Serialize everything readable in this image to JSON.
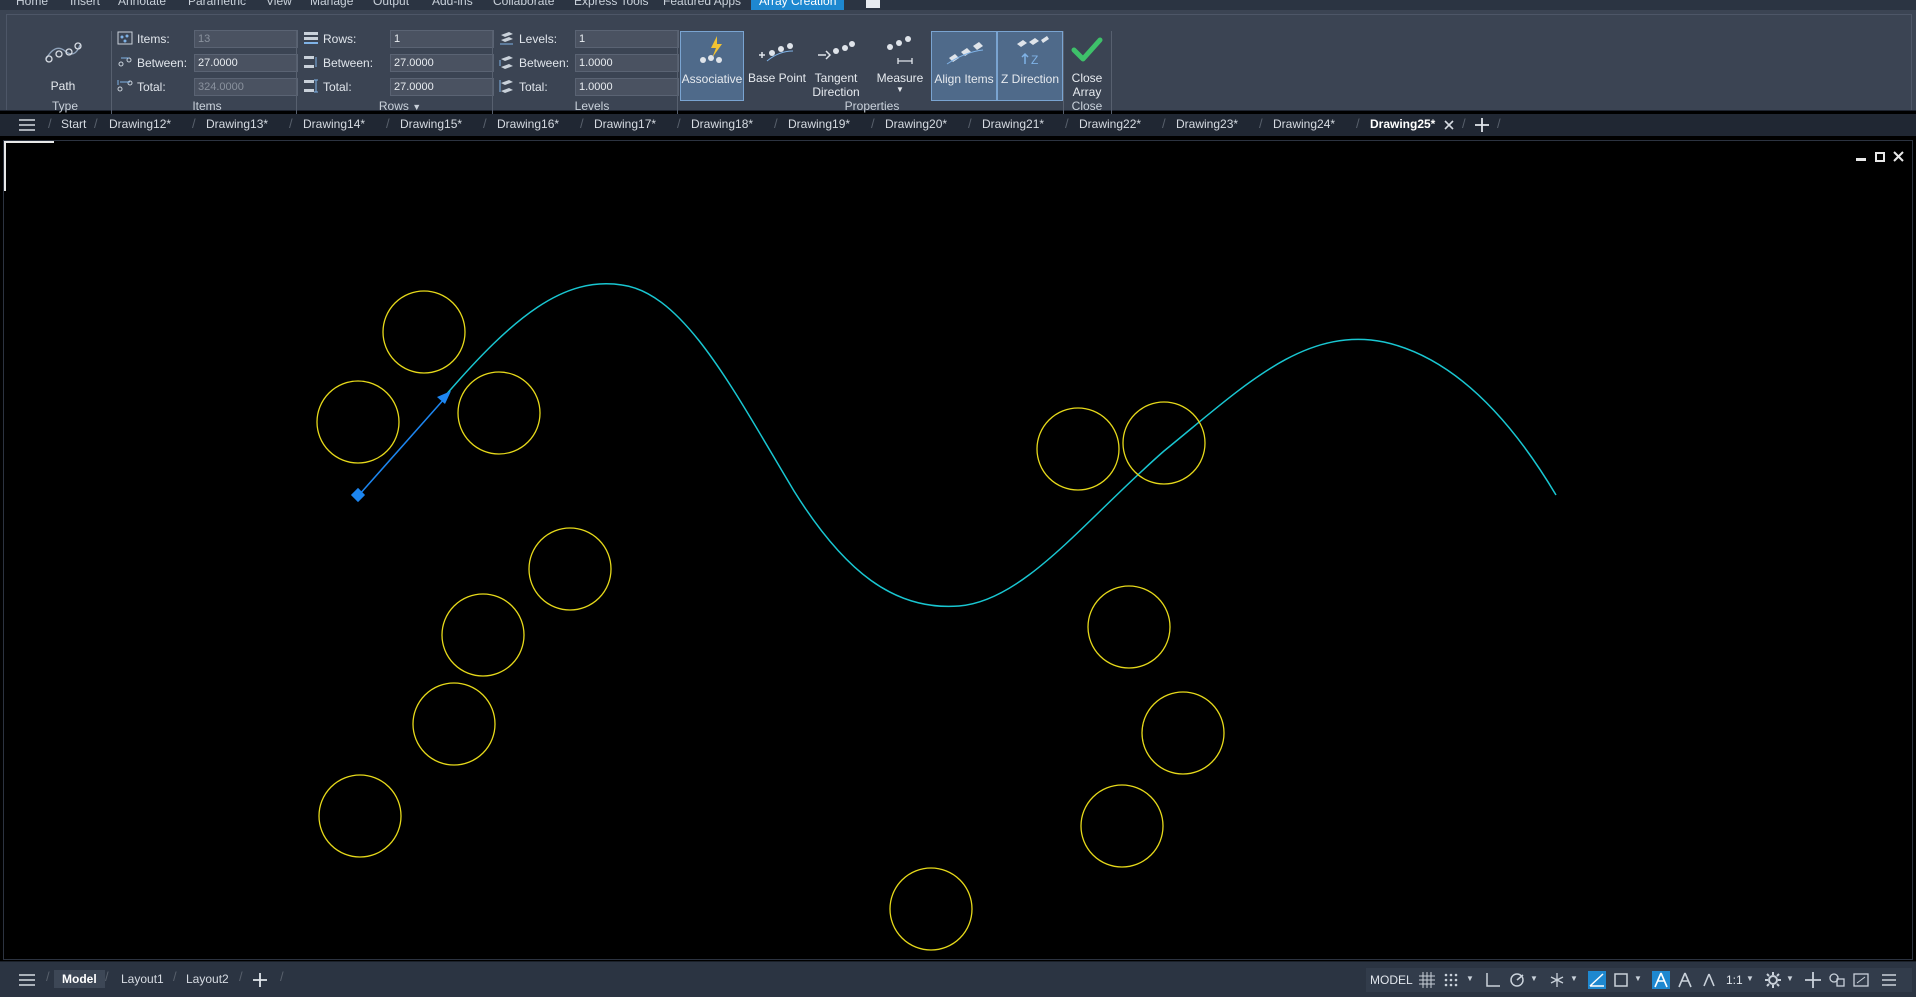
{
  "ribbon_tabs": [
    "Home",
    "Insert",
    "Annotate",
    "Parametric",
    "View",
    "Manage",
    "Output",
    "Add-ins",
    "Collaborate",
    "Express Tools",
    "Featured Apps",
    "Array Creation"
  ],
  "active_ribbon_tab": "Array Creation",
  "panels": {
    "type": {
      "title": "Type",
      "button": "Path"
    },
    "items": {
      "title": "Items",
      "items_label": "Items:",
      "items_value": "13",
      "between_label": "Between:",
      "between_value": "27.0000",
      "total_label": "Total:",
      "total_value": "324.0000"
    },
    "rows": {
      "title": "Rows",
      "rows_label": "Rows:",
      "rows_value": "1",
      "between_label": "Between:",
      "between_value": "27.0000",
      "total_label": "Total:",
      "total_value": "27.0000"
    },
    "levels": {
      "title": "Levels",
      "levels_label": "Levels:",
      "levels_value": "1",
      "between_label": "Between:",
      "between_value": "1.0000",
      "total_label": "Total:",
      "total_value": "1.0000"
    },
    "properties": {
      "title": "Properties",
      "associative": "Associative",
      "base_point": "Base Point",
      "tangent_1": "Tangent",
      "tangent_2": "Direction",
      "measure": "Measure",
      "align_items": "Align Items",
      "z_direction": "Z Direction"
    },
    "close": {
      "title": "Close",
      "close_1": "Close",
      "close_2": "Array"
    }
  },
  "doc_tabs": [
    "Start",
    "Drawing12*",
    "Drawing13*",
    "Drawing14*",
    "Drawing15*",
    "Drawing16*",
    "Drawing17*",
    "Drawing18*",
    "Drawing19*",
    "Drawing20*",
    "Drawing21*",
    "Drawing22*",
    "Drawing23*",
    "Drawing24*",
    "Drawing25*"
  ],
  "active_doc_tab": "Drawing25*",
  "layout_tabs": [
    "Model",
    "Layout1",
    "Layout2"
  ],
  "status": {
    "model_label": "MODEL",
    "scale": "1:1"
  },
  "colors": {
    "path": "#19c6d1",
    "circles": "#e5d81a",
    "grip": "#1d86f0",
    "ribbon": "#3b4453",
    "accent": "#1e88d0"
  },
  "icons": [
    "path-array-icon",
    "items-icon",
    "rows-icon",
    "levels-icon",
    "associative-icon",
    "base-point-icon",
    "tangent-icon",
    "measure-icon",
    "align-items-icon",
    "z-direction-icon",
    "checkmark-icon",
    "hamburger-icon",
    "plus-icon",
    "grid-icon",
    "snap-icon",
    "ortho-icon",
    "polar-icon",
    "osnap-icon",
    "gear-icon"
  ]
}
